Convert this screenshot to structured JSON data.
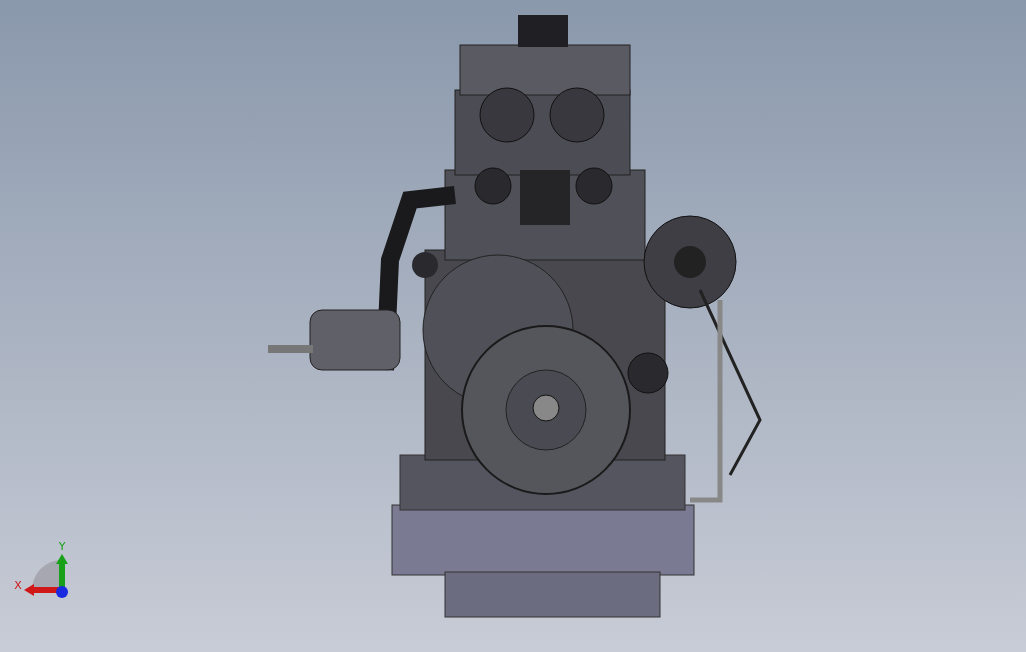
{
  "viewport": {
    "triad": {
      "axes": [
        {
          "kind": "x",
          "label": "X"
        },
        {
          "kind": "y",
          "label": "Y"
        }
      ]
    }
  }
}
